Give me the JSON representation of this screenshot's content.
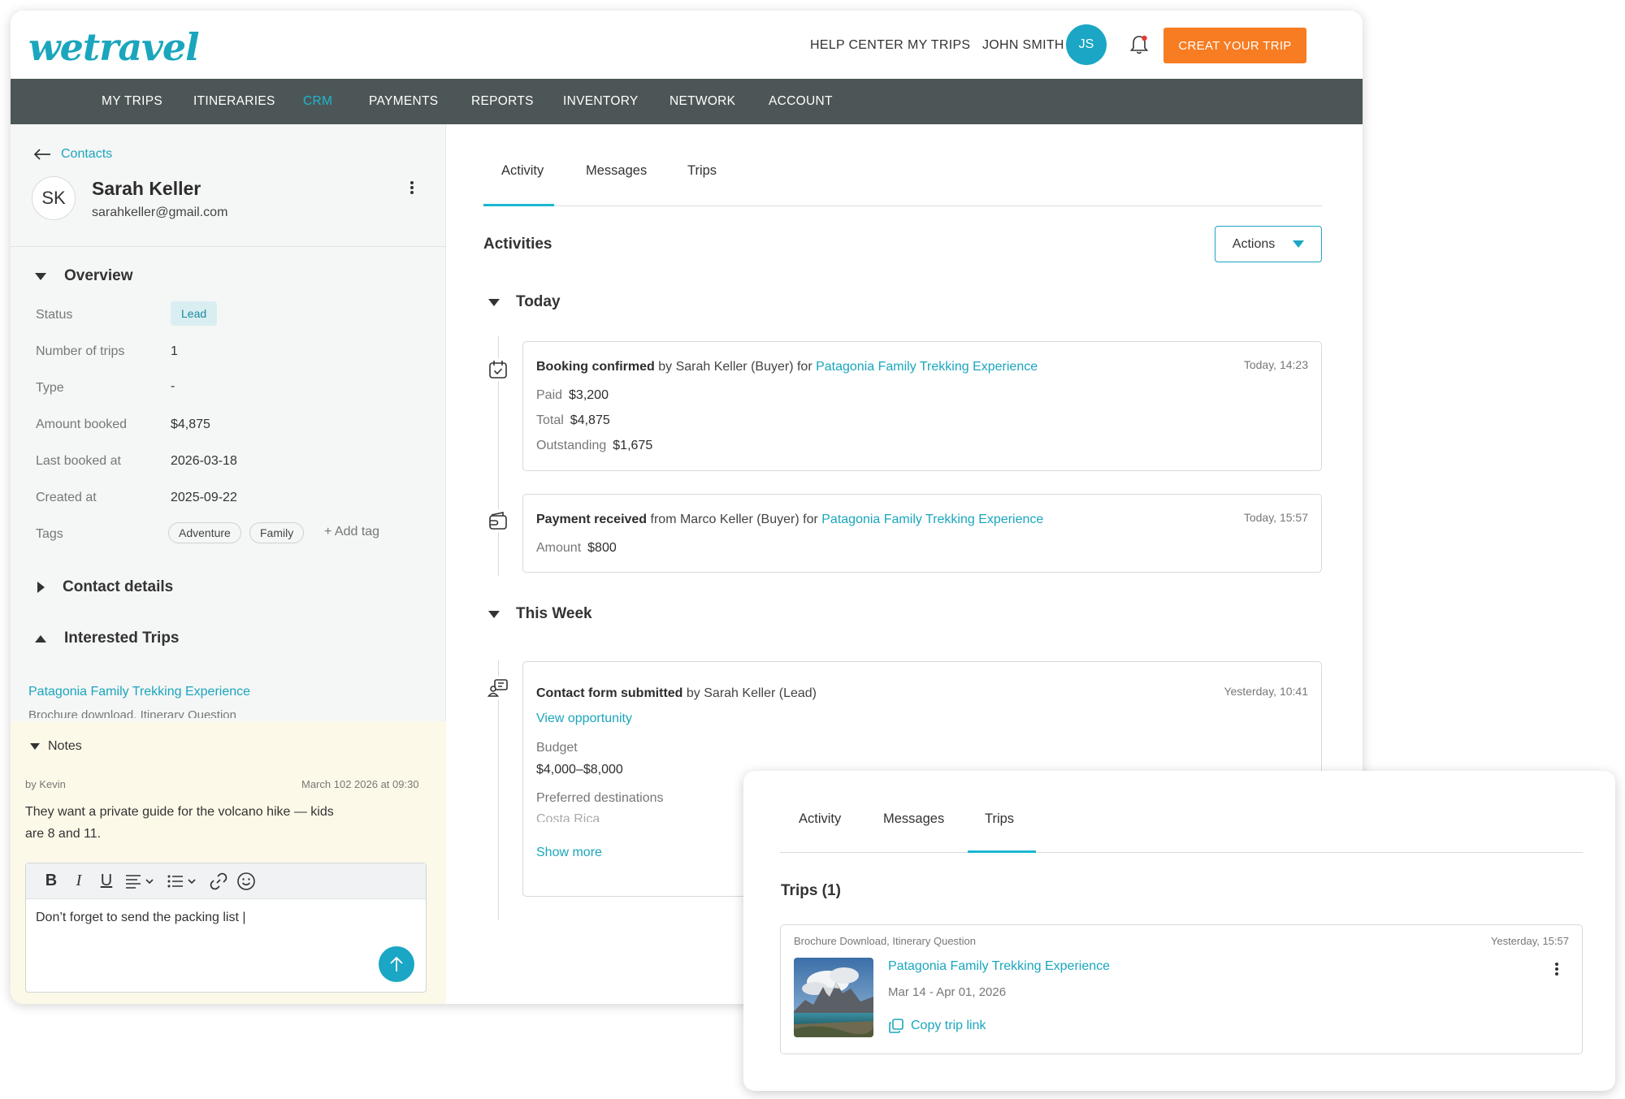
{
  "header": {
    "logo": "wetravel",
    "links": [
      "HELP CENTER",
      "MY TRIPS",
      "JOHN SMITH"
    ],
    "user_initials": "JS",
    "create_button": "CREAT YOUR TRIP"
  },
  "nav": {
    "items": [
      "MY TRIPS",
      "ITINERARIES",
      "CRM",
      "PAYMENTS",
      "REPORTS",
      "INVENTORY",
      "NETWORK",
      "ACCOUNT"
    ],
    "active": "CRM"
  },
  "contact": {
    "back_label": "Contacts",
    "initials": "SK",
    "name": "Sarah Keller",
    "email": "sarahkeller@gmail.com"
  },
  "overview": {
    "title": "Overview",
    "fields": [
      {
        "label": "Status",
        "value": "Lead"
      },
      {
        "label": "Number of trips",
        "value": "1"
      },
      {
        "label": "Type",
        "value": "-"
      },
      {
        "label": "Amount booked",
        "value": "$4,875"
      },
      {
        "label": "Last booked at",
        "value": "2026-03-18"
      },
      {
        "label": "Created at",
        "value": "2025-09-22"
      },
      {
        "label": "Tags",
        "value": ""
      }
    ],
    "tags": [
      "Adventure",
      "Family"
    ],
    "add_tag": "+ Add tag"
  },
  "contact_details": {
    "title": "Contact details"
  },
  "interested_trips": {
    "title": "Interested Trips",
    "trip": "Patagonia Family Trekking Experience",
    "sub": "Brochure download, Itinerary Question"
  },
  "notes": {
    "title": "Notes",
    "by": "by Kevin",
    "date": "March 102 2026 at 09:30",
    "text": "They want a private guide for the volcano hike — kids are 8 and 11.",
    "draft": "Don’t forget to send the packing list |"
  },
  "tabs": [
    "Activity",
    "Messages",
    "Trips"
  ],
  "activities": {
    "title": "Activities",
    "actions_label": "Actions",
    "groups": [
      {
        "title": "Today",
        "items": [
          {
            "event": "Booking confirmed",
            "by": "by Sarah Keller (Buyer) for",
            "trip": "Patagonia Family Trekking Experience",
            "time": "Today, 14:23",
            "details": [
              {
                "label": "Paid",
                "value": "$3,200"
              },
              {
                "label": "Total",
                "value": "$4,875"
              },
              {
                "label": "Outstanding",
                "value": "$1,675"
              }
            ]
          },
          {
            "event": "Payment received",
            "by": "from Marco Keller (Buyer) for",
            "trip": "Patagonia Family Trekking Experience",
            "time": "Today, 15:57",
            "details": [
              {
                "label": "Amount",
                "value": "$800"
              }
            ]
          }
        ]
      },
      {
        "title": "This Week",
        "items": [
          {
            "event": "Contact form submitted",
            "by": "by Sarah Keller (Lead)",
            "time": "Yesterday, 10:41",
            "link": "View opportunity",
            "budget_label": "Budget",
            "budget_value": "$4,000–$8,000",
            "dest_label": "Preferred destinations",
            "dest_value": "Costa Rica",
            "show_more": "Show more"
          }
        ]
      }
    ]
  },
  "popup": {
    "tabs": [
      "Activity",
      "Messages",
      "Trips"
    ],
    "active_tab": "Trips",
    "title": "Trips (1)",
    "trip": {
      "tags": "Brochure Download, Itinerary Question",
      "time": "Yesterday, 15:57",
      "title": "Patagonia Family Trekking Experience",
      "dates": "Mar 14 - Apr 01, 2026",
      "copy_label": "Copy trip link"
    }
  },
  "colors": {
    "accent": "#1aa6bd",
    "cta": "#f77c22",
    "nav_bg": "#4d5657",
    "notes_bg": "#fdf9e9"
  }
}
